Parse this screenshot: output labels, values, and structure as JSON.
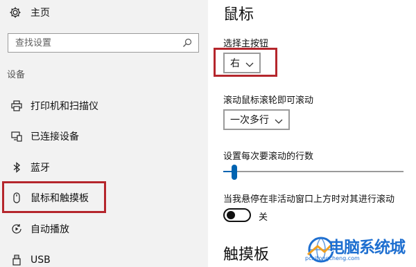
{
  "nav": {
    "home_label": "主页",
    "search_placeholder": "查找设置",
    "group_title": "设备",
    "items": [
      {
        "label": "打印机和扫描仪",
        "icon": "printer-icon"
      },
      {
        "label": "已连接设备",
        "icon": "connected-devices-icon"
      },
      {
        "label": "蓝牙",
        "icon": "bluetooth-icon"
      },
      {
        "label": "鼠标和触摸板",
        "icon": "mouse-icon",
        "selected": true
      },
      {
        "label": "自动播放",
        "icon": "autoplay-icon"
      },
      {
        "label": "USB",
        "icon": "usb-icon"
      }
    ]
  },
  "main": {
    "title": "鼠标",
    "primary_button_label": "选择主按钮",
    "primary_button_value": "右",
    "scroll_label": "滚动鼠标滚轮即可滚动",
    "scroll_value": "一次多行",
    "lines_label": "设置每次要滚动的行数",
    "lines_value_fraction": 0.06,
    "inactive_scroll_label": "当我悬停在非活动窗口上方时对其进行滚动",
    "inactive_scroll_state": "关",
    "touchpad_title": "触摸板"
  },
  "watermark": {
    "brand": "电脑系统城",
    "url": "pcxitongcheng.com"
  },
  "colors": {
    "accent": "#0063b1",
    "highlight_box": "#b5262c",
    "nav_background": "#f2f2f2",
    "watermark": "#1e6fd0"
  }
}
